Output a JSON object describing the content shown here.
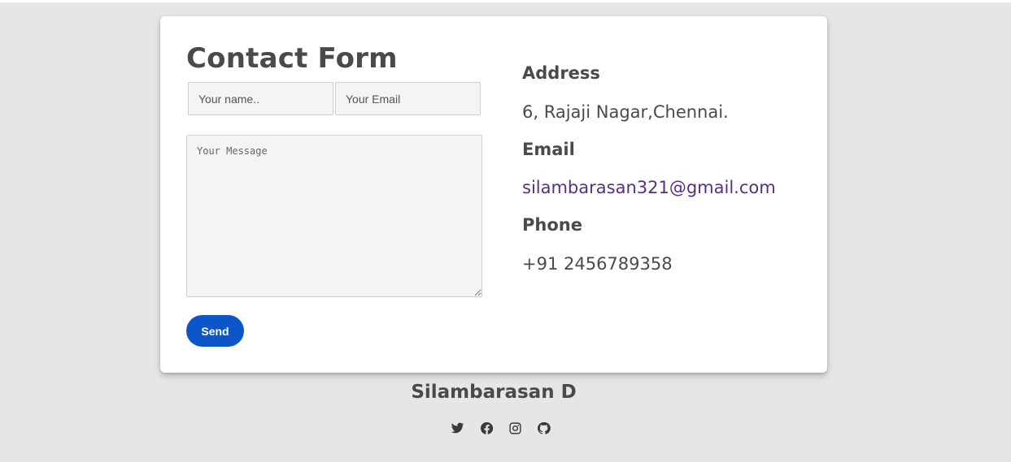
{
  "form": {
    "title": "Contact Form",
    "name_placeholder": "Your name..",
    "email_placeholder": "Your Email",
    "message_placeholder": "Your Message",
    "send_label": "Send"
  },
  "info": {
    "address_heading": "Address",
    "address_value": "6, Rajaji Nagar,Chennai.",
    "email_heading": "Email",
    "email_value": "silambarasan321@gmail.com",
    "phone_heading": "Phone",
    "phone_value": "+91 2456789358"
  },
  "footer": {
    "name": "Silambarasan D",
    "social_icons": [
      "twitter-icon",
      "facebook-icon",
      "instagram-icon",
      "github-icon"
    ]
  },
  "colors": {
    "background": "#e6e6e6",
    "card": "#ffffff",
    "accent_button": "#0d56c9",
    "link": "#5a2d86",
    "text": "#4a4a4a"
  }
}
